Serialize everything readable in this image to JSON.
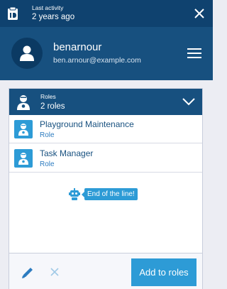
{
  "topbar": {
    "activity_label": "Last activity",
    "activity_value": "2 years ago"
  },
  "user": {
    "name": "benarnour",
    "email": "ben.arnour@example.com"
  },
  "roles": {
    "heading": "Roles",
    "count_label": "2 roles",
    "items": [
      {
        "name": "Playground Maintenance",
        "type": "Role"
      },
      {
        "name": "Task Manager",
        "type": "Role"
      }
    ],
    "end_message": "End of the line!"
  },
  "actions": {
    "add_label": "Add to roles"
  },
  "colors": {
    "topbar": "#0f426f",
    "header": "#17507f",
    "accent": "#2d9bd6",
    "background": "#ecedf3"
  },
  "icons": [
    "clipboard-icon",
    "close-icon",
    "user-icon",
    "hamburger-menu-icon",
    "user-role-icon",
    "chevron-down-icon",
    "robot-icon",
    "pencil-icon",
    "x-icon"
  ]
}
